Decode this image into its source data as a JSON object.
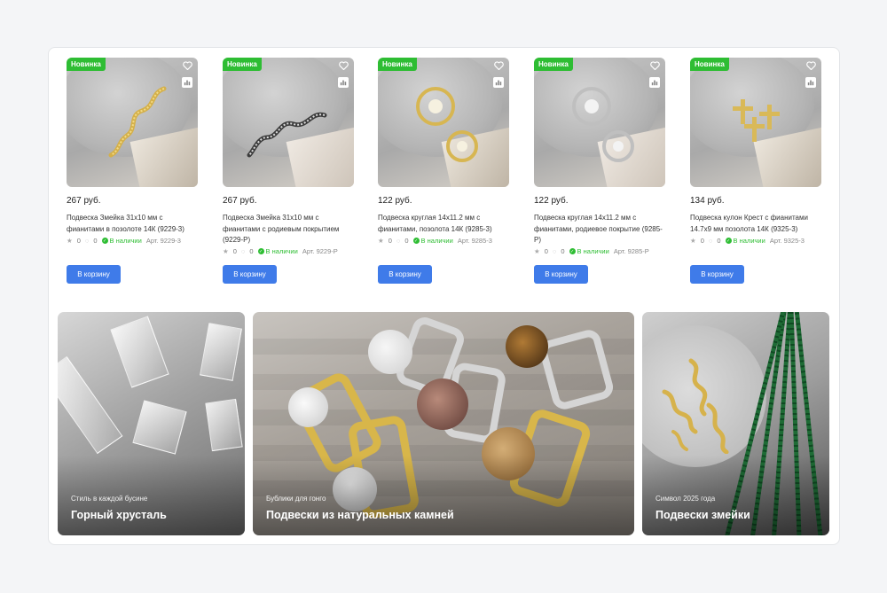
{
  "colors": {
    "accent": "#3f7be9",
    "badge": "#2ebd33",
    "in_stock": "#2ebd33"
  },
  "products": [
    {
      "badge": "Новинка",
      "price": "267 руб.",
      "title": "Подвеска Змейка 31х10 мм с фианитами в позолоте 14К (9229-3)",
      "rating": "0",
      "reviews": "0",
      "stock": "В наличии",
      "article": "Арт. 9229-3",
      "button": "В корзину"
    },
    {
      "badge": "Новинка",
      "price": "267 руб.",
      "title": "Подвеска Змейка 31х10 мм с фианитами с родиевым покрытием (9229-Р)",
      "rating": "0",
      "reviews": "0",
      "stock": "В наличии",
      "article": "Арт. 9229-Р",
      "button": "В корзину"
    },
    {
      "badge": "Новинка",
      "price": "122 руб.",
      "title": "Подвеска круглая 14х11.2 мм с фианитами, позолота 14К (9285-3)",
      "rating": "0",
      "reviews": "0",
      "stock": "В наличии",
      "article": "Арт. 9285-3",
      "button": "В корзину"
    },
    {
      "badge": "Новинка",
      "price": "122 руб.",
      "title": "Подвеска круглая 14х11.2 мм с фианитами, родиевое покрытие (9285-Р)",
      "rating": "0",
      "reviews": "0",
      "stock": "В наличии",
      "article": "Арт. 9285-Р",
      "button": "В корзину"
    },
    {
      "badge": "Новинка",
      "price": "134 руб.",
      "title": "Подвеска кулон Крест с фианитами 14.7х9 мм позолота 14К (9325-3)",
      "rating": "0",
      "reviews": "0",
      "stock": "В наличии",
      "article": "Арт. 9325-3",
      "button": "В корзину"
    }
  ],
  "banners": [
    {
      "subtitle": "Стиль в каждой бусине",
      "title": "Горный хрусталь"
    },
    {
      "subtitle": "Бублики для гонго",
      "title": "Подвески из натуральных камней"
    },
    {
      "subtitle": "Символ 2025 года",
      "title": "Подвески змейки"
    }
  ],
  "icons": {
    "favorite": "heart-icon",
    "compare": "bar-chart-icon",
    "rating": "star-icon",
    "reviews": "comment-icon",
    "stock": "check-circle-icon"
  }
}
